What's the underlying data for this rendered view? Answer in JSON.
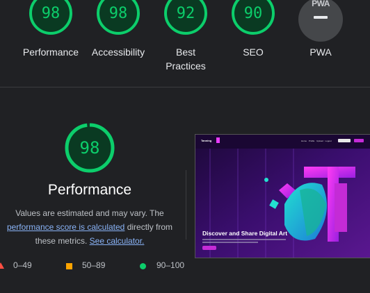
{
  "categories": [
    {
      "name": "Performance",
      "score": "98",
      "score_value": 98
    },
    {
      "name": "Accessibility",
      "score": "98",
      "score_value": 98
    },
    {
      "name": "Best Practices",
      "score": "92",
      "score_value": 92
    },
    {
      "name": "SEO",
      "score": "90",
      "score_value": 90
    },
    {
      "name": "PWA",
      "badge": "PWA"
    }
  ],
  "detail": {
    "score": "98",
    "score_value": 98,
    "title": "Performance",
    "desc_1": "Values are estimated and may vary. The ",
    "link_1": "performance score is calculated",
    "desc_2": " directly from these metrics. ",
    "link_2": "See calculator."
  },
  "legend": [
    {
      "range": "0–49",
      "color": "#ff4e42"
    },
    {
      "range": "50–89",
      "color": "#ffa400"
    },
    {
      "range": "90–100",
      "color": "#0cce6b"
    }
  ],
  "screenshot": {
    "brand": "Tanning",
    "nav": "Home Profile Upload Logout",
    "hero_title": "Discover and Share Digital Art"
  },
  "colors": {
    "pass": "#0cce6b",
    "average": "#ffa400",
    "fail": "#ff4e42",
    "background": "#202124",
    "link": "#8ab4f8"
  }
}
